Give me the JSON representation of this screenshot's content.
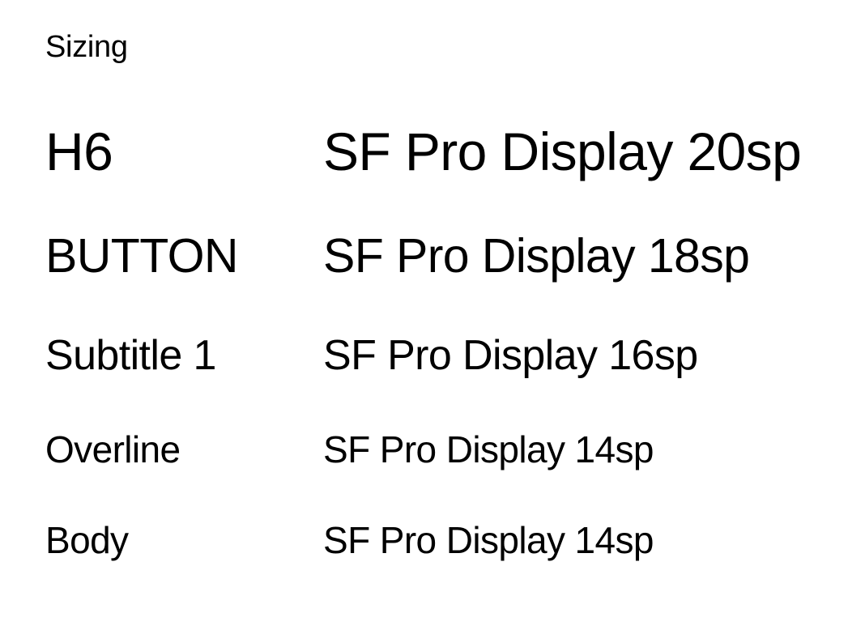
{
  "header": {
    "title": "Sizing"
  },
  "rows": [
    {
      "name": "H6",
      "spec": "SF Pro Display 20sp"
    },
    {
      "name": "BUTTON",
      "spec": "SF Pro Display 18sp"
    },
    {
      "name": "Subtitle 1",
      "spec": "SF Pro Display 16sp"
    },
    {
      "name": "Overline",
      "spec": "SF Pro Display 14sp"
    },
    {
      "name": "Body",
      "spec": "SF Pro Display 14sp"
    }
  ],
  "colors": {
    "text": "#000000",
    "background": "#ffffff"
  }
}
